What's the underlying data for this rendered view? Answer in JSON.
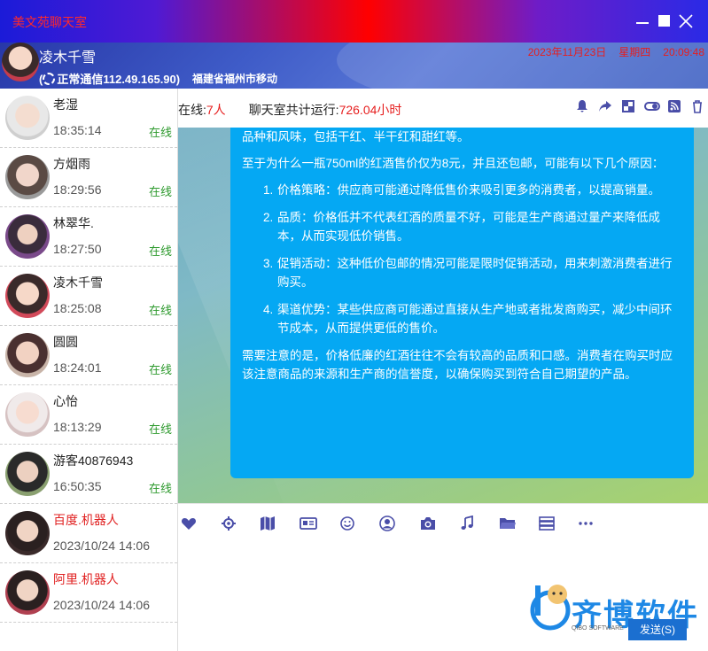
{
  "window": {
    "title": "美文苑聊天室"
  },
  "header": {
    "user_name": "凌木千雪",
    "status": "正常通信112.49.165.90)",
    "location": "福建省福州市移动",
    "date": "2023年11月23日",
    "weekday": "星期四",
    "time": "20:09:48"
  },
  "sidebar": {
    "users": [
      {
        "name": "老湿",
        "time": "18:35:14",
        "status": "在线",
        "type": "user"
      },
      {
        "name": "方烟雨",
        "time": "18:29:56",
        "status": "在线",
        "type": "user"
      },
      {
        "name": "林翠华.",
        "time": "18:27:50",
        "status": "在线",
        "type": "user"
      },
      {
        "name": "凌木千雪",
        "time": "18:25:08",
        "status": "在线",
        "type": "user"
      },
      {
        "name": "圆圆",
        "time": "18:24:01",
        "status": "在线",
        "type": "user"
      },
      {
        "name": "心怡",
        "time": "18:13:29",
        "status": "在线",
        "type": "user"
      },
      {
        "name": "游客40876943",
        "time": "16:50:35",
        "status": "在线",
        "type": "user"
      },
      {
        "name": "百度.机器人",
        "time": "2023/10/24 14:06",
        "status": "",
        "type": "bot"
      },
      {
        "name": "阿里.机器人",
        "time": "2023/10/24 14:06",
        "status": "",
        "type": "bot"
      }
    ]
  },
  "infobar": {
    "online_label": "在线:",
    "online_count": "7人",
    "runtime_label": "聊天室共计运行:",
    "runtime_value": "726.04小时"
  },
  "message": {
    "intro_tail": "品种和风味，包括干红、半干红和甜红等。",
    "question": "至于为什么一瓶750ml的红酒售价仅为8元，并且还包邮，可能有以下几个原因：",
    "points": [
      {
        "num": "1.",
        "text": "价格策略：供应商可能通过降低售价来吸引更多的消费者，以提高销量。"
      },
      {
        "num": "2.",
        "text": "品质：价格低并不代表红酒的质量不好，可能是生产商通过量产来降低成本，从而实现低价销售。"
      },
      {
        "num": "3.",
        "text": "促销活动：这种低价包邮的情况可能是限时促销活动，用来刺激消费者进行购买。"
      },
      {
        "num": "4.",
        "text": "渠道优势：某些供应商可能通过直接从生产地或者批发商购买，减少中间环节成本，从而提供更低的售价。"
      }
    ],
    "conclusion": "需要注意的是，价格低廉的红酒往往不会有较高的品质和口感。消费者在购买时应该注意商品的来源和生产商的信誉度，以确保购买到符合自己期望的产品。"
  },
  "input": {
    "send_label": "发送(S)"
  },
  "watermark": {
    "text": "齐博软件",
    "sub": "QIBO SOFTWARE"
  },
  "colors": {
    "bubble": "#05a8f3",
    "online": "#2e9a2e",
    "accent_red": "#e61e1e",
    "icon": "#4a4ea8"
  }
}
